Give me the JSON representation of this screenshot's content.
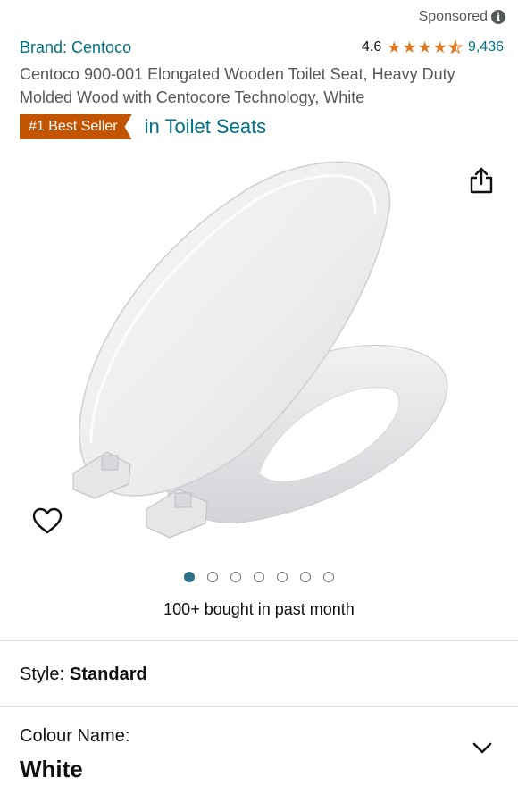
{
  "header": {
    "sponsored_label": "Sponsored",
    "info_icon_glyph": "i"
  },
  "product": {
    "brand": "Brand: Centoco",
    "rating_value": "4.6",
    "rating_stars": 4.5,
    "rating_count": "9,436",
    "title": "Centoco 900-001 Elongated Wooden Toilet Seat, Heavy Duty Molded Wood with Centocore Technology, White",
    "badge_label": "#1 Best Seller",
    "badge_category": "in Toilet Seats",
    "image_icon": "toilet-seat-product-image"
  },
  "gallery": {
    "dot_count": 7,
    "active_index": 0
  },
  "social_proof": {
    "bought_text": "100+ bought in past month"
  },
  "options": {
    "style_label": "Style:",
    "style_value": "Standard",
    "colour_label": "Colour Name:",
    "colour_value": "White"
  },
  "colors": {
    "link": "#007185",
    "star": "#de7921",
    "badge": "#c45500",
    "active_dot": "#2f6f8a"
  },
  "icons": [
    "info-icon",
    "star-icon",
    "share-icon",
    "heart-icon",
    "chevron-down-icon"
  ]
}
